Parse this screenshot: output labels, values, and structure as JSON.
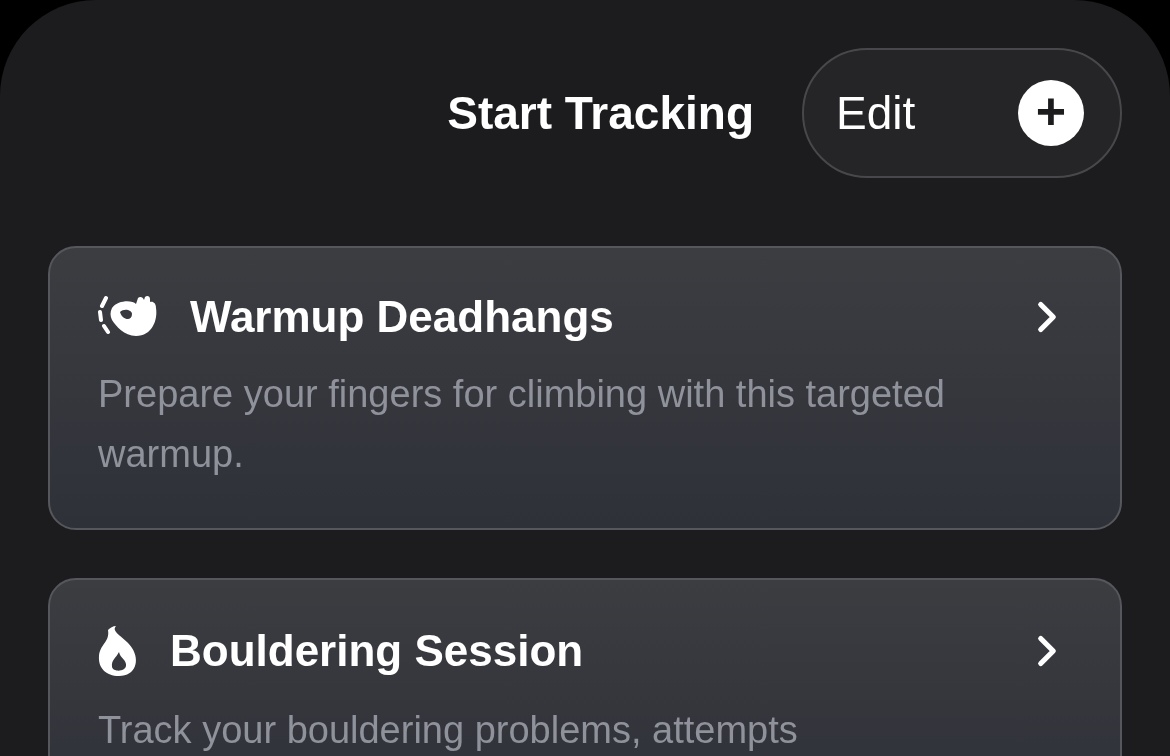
{
  "header": {
    "title": "Start Tracking",
    "edit_button": "Edit",
    "add_button": "+"
  },
  "cards": [
    {
      "kind": "hand",
      "title": "Warmup Deadhangs",
      "description": "Prepare your fingers for climbing with this targeted warmup."
    },
    {
      "kind": "flame",
      "title": "Bouldering Session",
      "description": "Track your bouldering problems, attempts"
    }
  ]
}
